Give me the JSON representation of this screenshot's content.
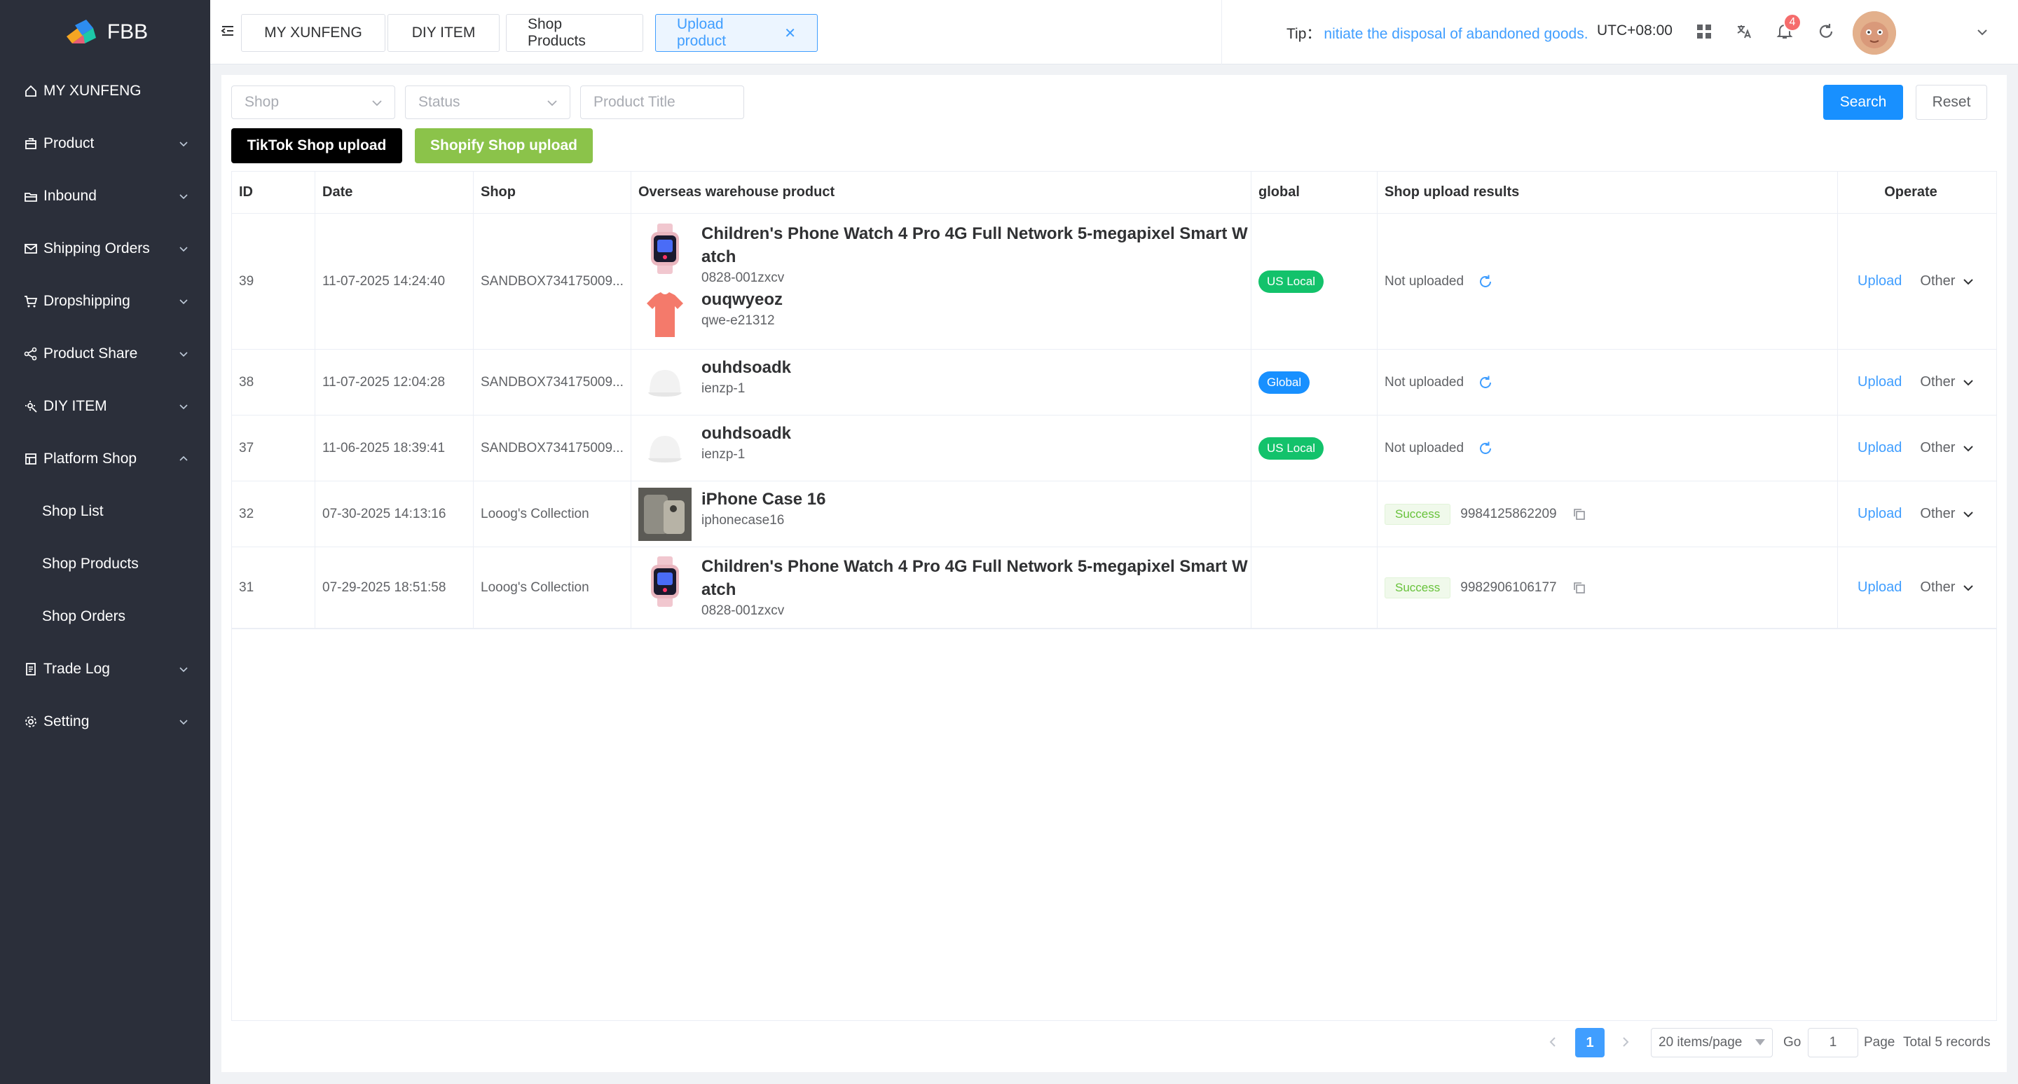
{
  "app": {
    "logo_text": "FBB"
  },
  "sidebar": {
    "items": [
      {
        "label": "MY XUNFENG",
        "icon": "home-icon"
      },
      {
        "label": "Product",
        "icon": "product-icon"
      },
      {
        "label": "Inbound",
        "icon": "inbound-icon"
      },
      {
        "label": "Shipping Orders",
        "icon": "mail-icon"
      },
      {
        "label": "Dropshipping",
        "icon": "cart-icon"
      },
      {
        "label": "Product Share",
        "icon": "share-icon"
      },
      {
        "label": "DIY ITEM",
        "icon": "diy-icon"
      },
      {
        "label": "Platform Shop",
        "icon": "shop-icon"
      },
      {
        "label": "Trade Log",
        "icon": "log-icon"
      },
      {
        "label": "Setting",
        "icon": "gear-icon"
      }
    ],
    "sub_items": [
      "Shop List",
      "Shop Products",
      "Shop Orders"
    ]
  },
  "header": {
    "tabs": [
      "MY XUNFENG",
      "DIY ITEM",
      "Shop Products",
      "Upload product"
    ],
    "active_tab": "Upload product",
    "tip_label": "Tip：",
    "tip_text": "nitiate the disposal of abandoned goods.",
    "timezone": "UTC+08:00",
    "notification_count": "4"
  },
  "filters": {
    "shop_placeholder": "Shop",
    "status_placeholder": "Status",
    "title_placeholder": "Product Title",
    "search_label": "Search",
    "reset_label": "Reset",
    "tiktok_label": "TikTok Shop upload",
    "shopify_label": "Shopify Shop upload"
  },
  "table": {
    "headers": [
      "ID",
      "Date",
      "Shop",
      "Overseas warehouse product",
      "global",
      "Shop upload results",
      "Operate"
    ],
    "rows": [
      {
        "id": "39",
        "date": "11-07-2025 14:24:40",
        "shop": "SANDBOX734175009...",
        "products": [
          {
            "title": "Children's Phone Watch 4 Pro 4G Full Network 5-megapixel Smart Watch",
            "sku": "0828-001zxcv",
            "thumb": "watch"
          },
          {
            "title": "ouqwyeoz",
            "sku": "qwe-e21312",
            "thumb": "tshirt"
          }
        ],
        "global": "US Local",
        "global_color": "#13c26b",
        "result": "Not uploaded",
        "result_id": "",
        "upload": "Upload",
        "other": "Other"
      },
      {
        "id": "38",
        "date": "11-07-2025 12:04:28",
        "shop": "SANDBOX734175009...",
        "products": [
          {
            "title": "ouhdsoadk",
            "sku": "ienzp-1",
            "thumb": "cap"
          }
        ],
        "global": "Global",
        "global_color": "#1890ff",
        "result": "Not uploaded",
        "result_id": "",
        "upload": "Upload",
        "other": "Other"
      },
      {
        "id": "37",
        "date": "11-06-2025 18:39:41",
        "shop": "SANDBOX734175009...",
        "products": [
          {
            "title": "ouhdsoadk",
            "sku": "ienzp-1",
            "thumb": "cap"
          }
        ],
        "global": "US Local",
        "global_color": "#13c26b",
        "result": "Not uploaded",
        "result_id": "",
        "upload": "Upload",
        "other": "Other"
      },
      {
        "id": "32",
        "date": "07-30-2025 14:13:16",
        "shop": "Looog's Collection",
        "products": [
          {
            "title": "iPhone Case 16",
            "sku": "iphonecase16",
            "thumb": "photo"
          }
        ],
        "global": "",
        "global_color": "",
        "result": "Success",
        "result_id": "9984125862209",
        "upload": "Upload",
        "other": "Other"
      },
      {
        "id": "31",
        "date": "07-29-2025 18:51:58",
        "shop": "Looog's Collection",
        "products": [
          {
            "title": "Children's Phone Watch 4 Pro 4G Full Network 5-megapixel Smart Watch",
            "sku": "0828-001zxcv",
            "thumb": "watch"
          }
        ],
        "global": "",
        "global_color": "",
        "result": "Success",
        "result_id": "9982906106177",
        "upload": "Upload",
        "other": "Other"
      }
    ]
  },
  "pagination": {
    "current": "1",
    "page_size": "20 items/page",
    "go_label": "Go",
    "go_value": "1",
    "page_label": "Page",
    "total": "Total 5 records"
  }
}
